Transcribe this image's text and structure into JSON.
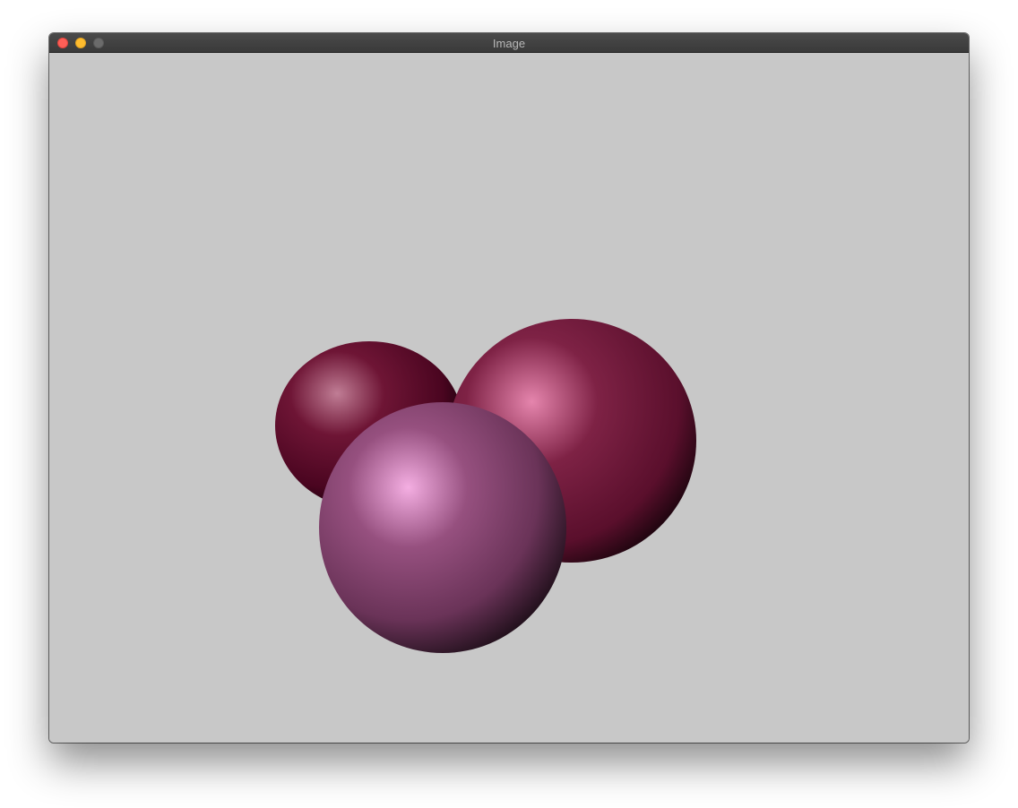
{
  "window": {
    "title": "Image",
    "controls": [
      {
        "name": "close",
        "color": "#fe5f57",
        "border": "#e0443e"
      },
      {
        "name": "minimize",
        "color": "#febc2e",
        "border": "#dea123"
      },
      {
        "name": "zoom",
        "color": "#6b6b6b",
        "border": "#5a5a5a"
      }
    ]
  },
  "scene": {
    "background_color": "#c8c8c8",
    "spheres": [
      {
        "name": "back-left-sphere",
        "highlight": "#c07d95",
        "mid": "#6e1535",
        "base": "#4a0520",
        "shadow": "#000000"
      },
      {
        "name": "back-right-sphere",
        "highlight": "#e585ad",
        "mid": "#7e2245",
        "base": "#5a0f2c",
        "shadow": "#000000"
      },
      {
        "name": "front-sphere",
        "highlight": "#f4aee2",
        "mid": "#96507f",
        "base": "#6a3358",
        "shadow": "#000000"
      }
    ]
  }
}
